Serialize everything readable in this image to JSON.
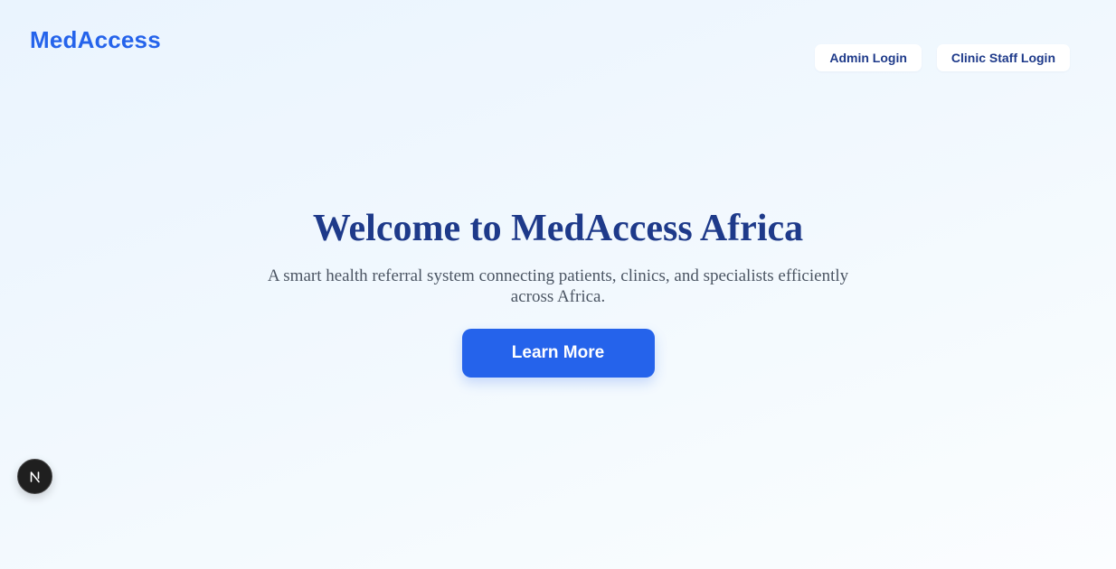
{
  "header": {
    "logo_text": "MedAccess",
    "nav": {
      "admin_login": "Admin Login",
      "clinic_staff_login": "Clinic Staff Login"
    }
  },
  "hero": {
    "title": "Welcome to MedAccess Africa",
    "subtitle": "A smart health referral system connecting patients, clinics, and specialists efficiently across Africa.",
    "cta_label": "Learn More"
  },
  "dev_tools": {
    "icon": "nextjs-n-icon"
  },
  "colors": {
    "brand": "#2563eb",
    "heading": "#1e3a8a",
    "body_text": "#4b5563",
    "background": "#eef6fe"
  }
}
